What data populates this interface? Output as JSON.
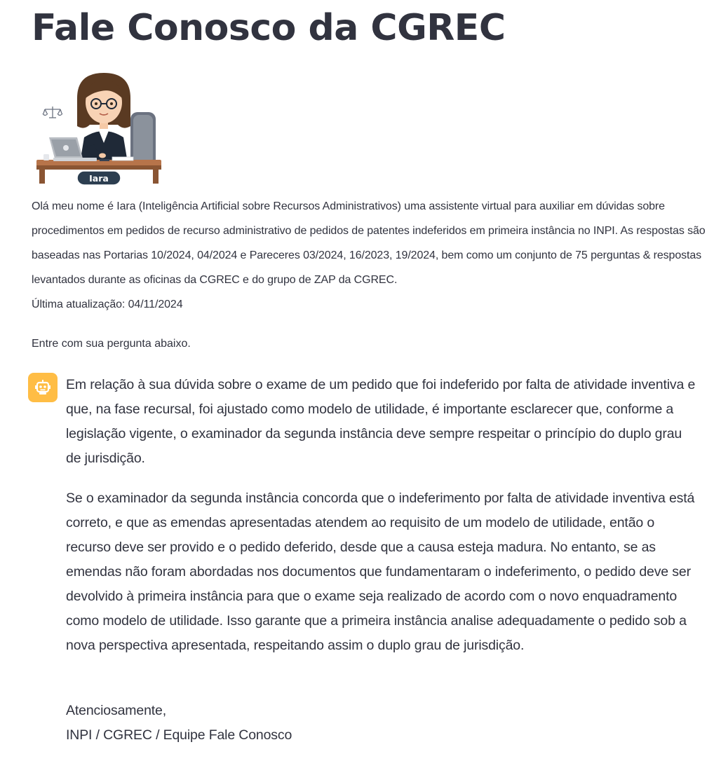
{
  "page": {
    "title": "Fale Conosco da CGREC"
  },
  "assistant": {
    "name_badge": "Iara",
    "avatar_icon": "assistant-avatar-illustration"
  },
  "intro": {
    "text": "Olá meu nome é Iara (Inteligência Artificial sobre Recursos Administrativos) uma assistente virtual para auxiliar em dúvidas sobre procedimentos em pedidos de recurso administrativo de pedidos de patentes indeferidos em primeira instância no INPI. As respostas são baseadas nas Portarias 10/2024, 04/2024 e Pareceres 03/2024, 16/2023, 19/2024, bem como um conjunto de 75 perguntas & respostas levantados durante as oficinas da CGREC e do grupo de ZAP da CGREC.",
    "last_update": "Última atualização: 04/11/2024",
    "prompt": "Entre com sua pergunta abaixo."
  },
  "chat": {
    "icon": "robot-icon",
    "icon_color": "#ffbd45",
    "message": {
      "paragraph_1": "Em relação à sua dúvida sobre o exame de um pedido que foi indeferido por falta de atividade inventiva e que, na fase recursal, foi ajustado como modelo de utilidade, é importante esclarecer que, conforme a legislação vigente, o examinador da segunda instância deve sempre respeitar o princípio do duplo grau de jurisdição.",
      "paragraph_2": "Se o examinador da segunda instância concorda que o indeferimento por falta de atividade inventiva está correto, e que as emendas apresentadas atendem ao requisito de um modelo de utilidade, então o recurso deve ser provido e o pedido deferido, desde que a causa esteja madura. No entanto, se as emendas não foram abordadas nos documentos que fundamentaram o indeferimento, o pedido deve ser devolvido à primeira instância para que o exame seja realizado de acordo com o novo enquadramento como modelo de utilidade. Isso garante que a primeira instância analise adequadamente o pedido sob a nova perspectiva apresentada, respeitando assim o duplo grau de jurisdição.",
      "closing": "Atenciosamente,",
      "signature": "INPI / CGREC / Equipe Fale Conosco"
    }
  }
}
